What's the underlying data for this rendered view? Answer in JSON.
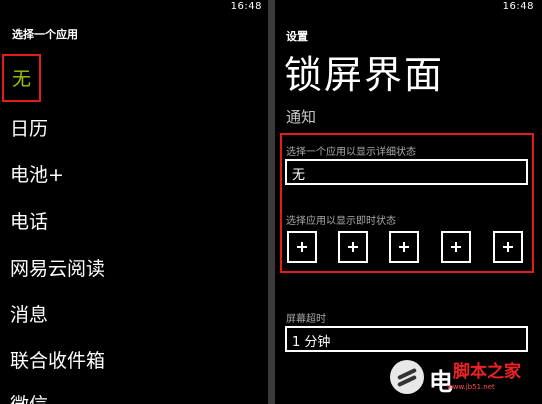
{
  "left_screen": {
    "status_time": "16:48",
    "title": "选择一个应用",
    "apps": [
      "无",
      "日历",
      "电池+",
      "电话",
      "网易云阅读",
      "消息",
      "联合收件箱",
      "微信"
    ],
    "selected_index": 0
  },
  "right_screen": {
    "status_time": "16:48",
    "settings_label": "设置",
    "page_title": "锁屏界面",
    "notifications_title": "通知",
    "detail_status_label": "选择一个应用以显示详细状态",
    "detail_status_value": "无",
    "quick_status_label": "选择应用以显示即时状态",
    "quick_status_slots": 5,
    "screen_timeout_label": "屏幕超时",
    "screen_timeout_value": "1 分钟"
  },
  "watermark": {
    "mark": "电",
    "brand": "脚本之家",
    "domain": "www.jb51.net"
  },
  "colors": {
    "background": "#000000",
    "accent_selected": "#a4c400",
    "highlight_border": "#e31c1c",
    "divider": "#3a3a3a"
  },
  "icons": [
    "plus-icon",
    "watermark-logo-icon"
  ]
}
